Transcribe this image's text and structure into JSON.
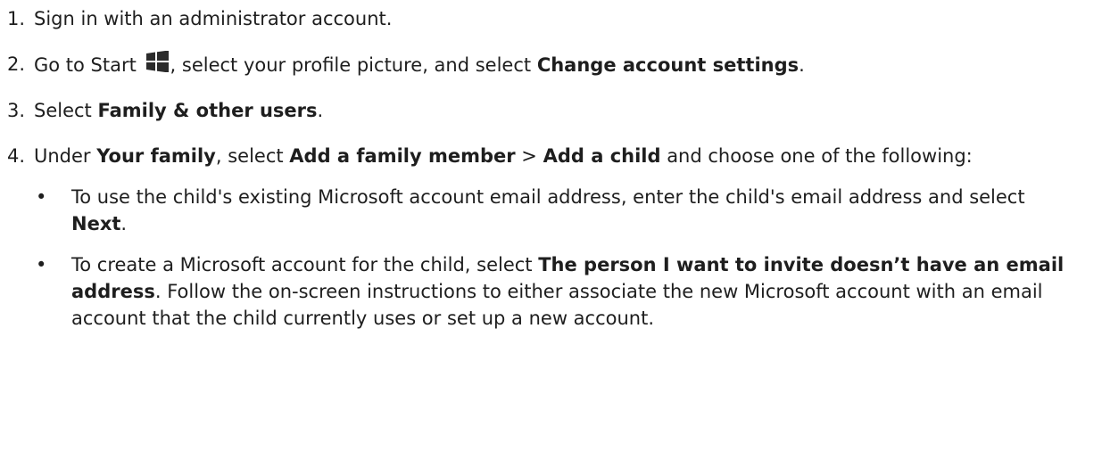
{
  "steps": [
    {
      "number": "1.",
      "text_1": "Sign in with an administrator account."
    },
    {
      "number": "2.",
      "text_1": "Go to Start ",
      "icon": "windows-logo-icon",
      "text_2": ", select your profile picture, and select ",
      "bold_1": "Change account settings",
      "text_3": "."
    },
    {
      "number": "3.",
      "text_1": "Select ",
      "bold_1": "Family & other users",
      "text_2": "."
    },
    {
      "number": "4.",
      "text_1": "Under ",
      "bold_1": "Your family",
      "text_2": ", select ",
      "bold_2": "Add a family member",
      "text_3": " > ",
      "bold_3": "Add a child",
      "text_4": " and choose one of the following:"
    }
  ],
  "bullets": [
    {
      "symbol": "•",
      "text_1": "To use the child's existing Microsoft account email address, enter the child's email address and select ",
      "bold_1": "Next",
      "text_2": "."
    },
    {
      "symbol": "•",
      "text_1": "To create a Microsoft account for the child, select ",
      "bold_1": "The person I want to invite doesn’t have an email address",
      "text_2": ". Follow the on-screen instructions to either associate the new Microsoft account with an email account that the child currently uses or set up a new account."
    }
  ],
  "colors": {
    "text": "#1e1e1e",
    "background": "#ffffff",
    "icon": "#2b2b2b"
  }
}
